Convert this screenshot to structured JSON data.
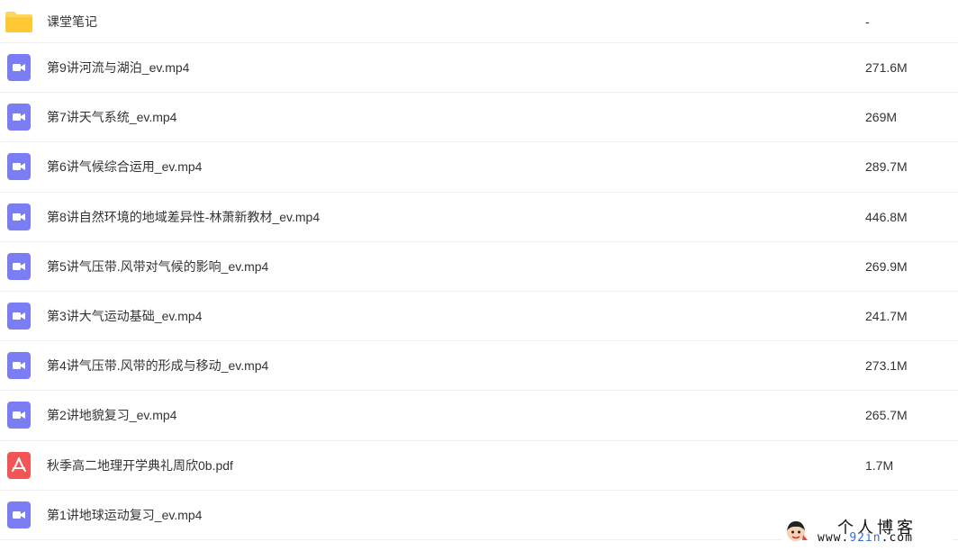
{
  "files": [
    {
      "icon": "folder-icon",
      "name": "课堂笔记",
      "size": "-"
    },
    {
      "icon": "video-icon",
      "name": "第9讲河流与湖泊_ev.mp4",
      "size": "271.6M"
    },
    {
      "icon": "video-icon",
      "name": "第7讲天气系统_ev.mp4",
      "size": "269M"
    },
    {
      "icon": "video-icon",
      "name": "第6讲气候综合运用_ev.mp4",
      "size": "289.7M"
    },
    {
      "icon": "video-icon",
      "name": "第8讲自然环境的地域差异性-林萧新教材_ev.mp4",
      "size": "446.8M"
    },
    {
      "icon": "video-icon",
      "name": "第5讲气压带.风带对气候的影响_ev.mp4",
      "size": "269.9M"
    },
    {
      "icon": "video-icon",
      "name": "第3讲大气运动基础_ev.mp4",
      "size": "241.7M"
    },
    {
      "icon": "video-icon",
      "name": "第4讲气压带.风带的形成与移动_ev.mp4",
      "size": "273.1M"
    },
    {
      "icon": "video-icon",
      "name": "第2讲地貌复习_ev.mp4",
      "size": "265.7M"
    },
    {
      "icon": "pdf-icon",
      "name": "秋季高二地理开学典礼周欣0b.pdf",
      "size": "1.7M"
    },
    {
      "icon": "video-icon",
      "name": "第1讲地球运动复习_ev.mp4",
      "size": ""
    }
  ],
  "watermark": {
    "title": "个人博客",
    "url_prefix": "www.",
    "url_domain": "92in",
    "url_suffix": ".com"
  },
  "colors": {
    "folder": "#ffd55c",
    "video": "#7b7ef3",
    "pdf": "#f25555",
    "text": "#333333",
    "divider": "#eeeeee"
  }
}
